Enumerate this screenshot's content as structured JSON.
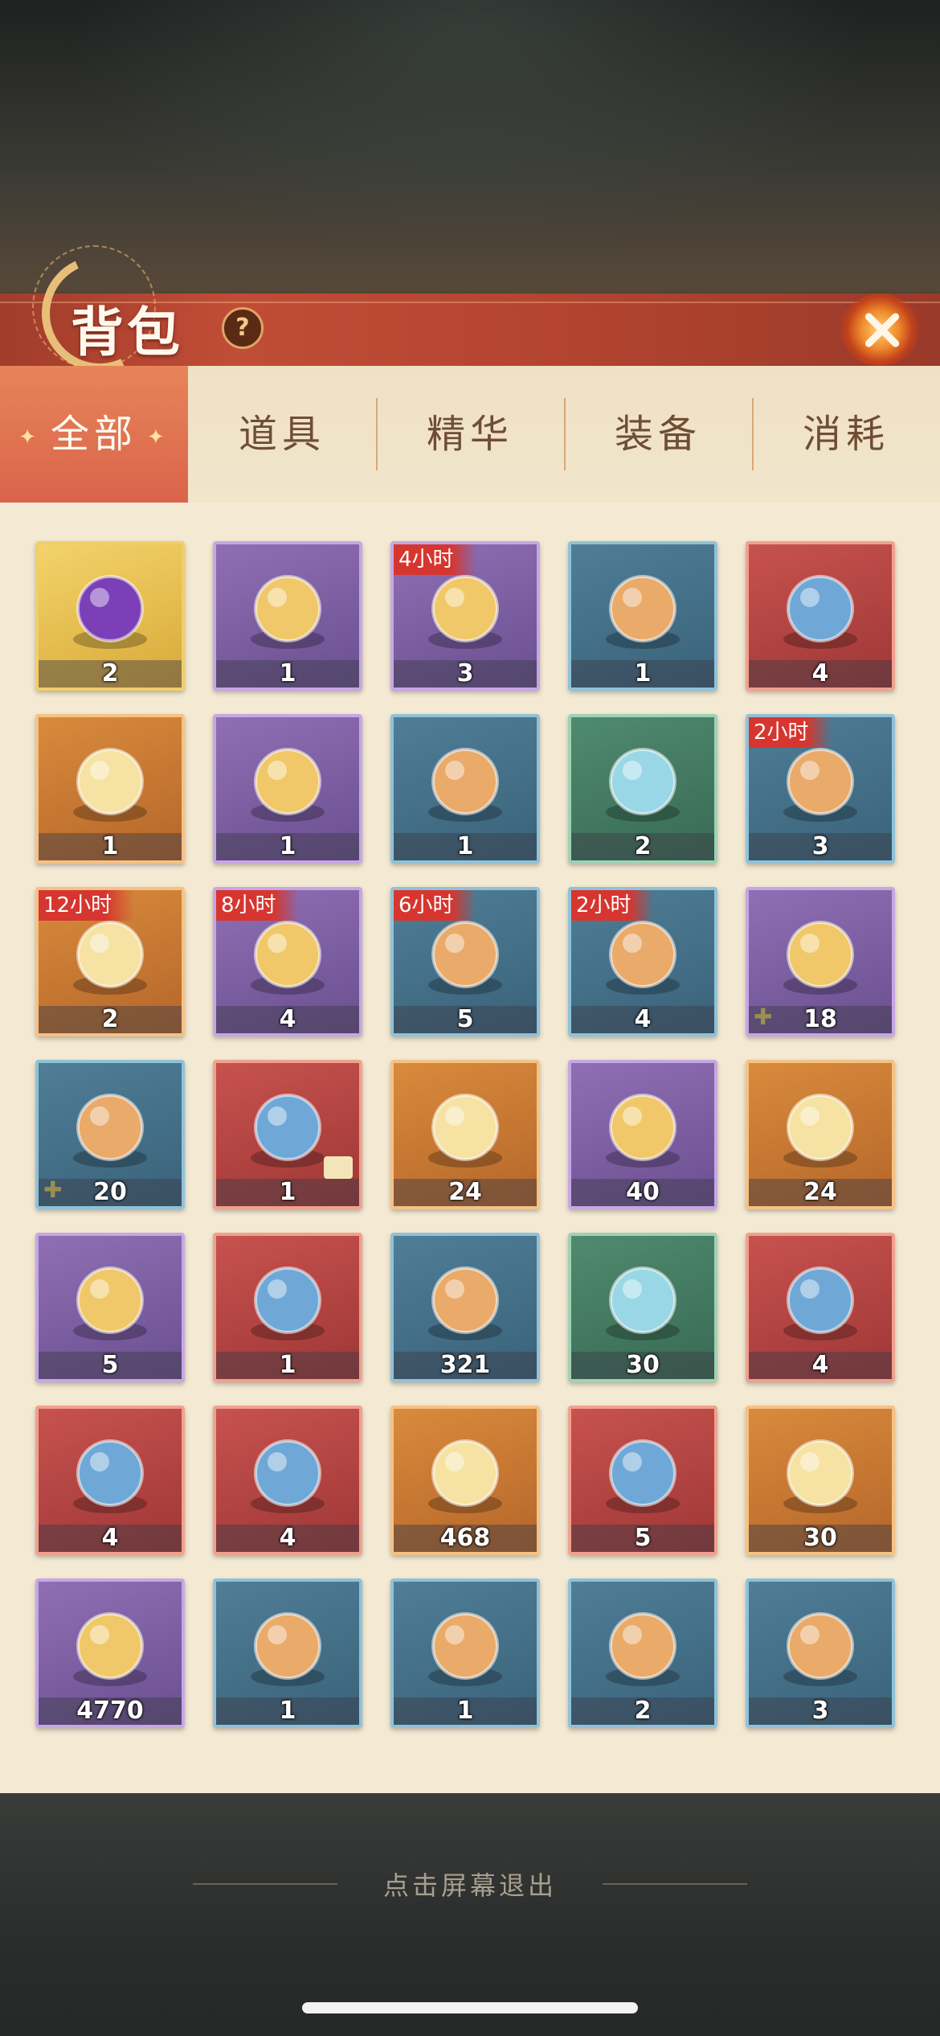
{
  "title": "背包",
  "help_label": "?",
  "tabs": [
    "全部",
    "道具",
    "精华",
    "装备",
    "消耗"
  ],
  "active_tab": "全部",
  "exit_hint": "点击屏幕退出",
  "colors": {
    "title_banner": "#b3442f",
    "active_tab": "#d9644a",
    "panel": "#f4ead4",
    "timer_badge": "#d6362f"
  },
  "items": [
    {
      "icon": "purple-pouch-icon",
      "rarity": "gold",
      "count": "2"
    },
    {
      "icon": "golden-chest-icon",
      "rarity": "purple",
      "count": "1"
    },
    {
      "icon": "orb-treasure-chest-icon",
      "rarity": "purple",
      "count": "3",
      "timer": "4小时"
    },
    {
      "icon": "red-orb-bag-icon",
      "rarity": "blue",
      "count": "1"
    },
    {
      "icon": "blue-pouch-icon",
      "rarity": "red",
      "count": "4"
    },
    {
      "icon": "hero-portrait-box-icon",
      "rarity": "orange",
      "count": "1"
    },
    {
      "icon": "card-box-icon",
      "rarity": "purple",
      "count": "1"
    },
    {
      "icon": "mystery-chest-icon",
      "rarity": "blue",
      "count": "1"
    },
    {
      "icon": "mystery-chest-icon",
      "rarity": "green",
      "count": "2"
    },
    {
      "icon": "orange-orbs-icon",
      "rarity": "blue",
      "count": "3",
      "timer": "2小时"
    },
    {
      "icon": "emerald-chest-icon",
      "rarity": "orange",
      "count": "2",
      "timer": "12小时"
    },
    {
      "icon": "emerald-sack-icon",
      "rarity": "purple",
      "count": "4",
      "timer": "8小时"
    },
    {
      "icon": "emerald-sack-icon",
      "rarity": "blue",
      "count": "5",
      "timer": "6小时"
    },
    {
      "icon": "emerald-pile-icon",
      "rarity": "blue",
      "count": "4",
      "timer": "2小时"
    },
    {
      "icon": "purple-spirit-flame-icon",
      "rarity": "purple",
      "count": "18",
      "fragment": true
    },
    {
      "icon": "blue-spirit-flame-icon",
      "rarity": "blue",
      "count": "20",
      "fragment": true
    },
    {
      "icon": "skin-card-icon",
      "rarity": "red",
      "count": "1",
      "skin": true
    },
    {
      "icon": "purple-potion-bowl-icon",
      "rarity": "orange",
      "count": "24"
    },
    {
      "icon": "potion-flask-icon",
      "rarity": "purple",
      "count": "40"
    },
    {
      "icon": "gold-scroll-icon",
      "rarity": "orange",
      "count": "24"
    },
    {
      "icon": "white-scroll-icon",
      "rarity": "purple",
      "count": "5"
    },
    {
      "icon": "rune-talisman-icon",
      "rarity": "red",
      "count": "1"
    },
    {
      "icon": "ore-stone-icon",
      "rarity": "blue",
      "count": "321"
    },
    {
      "icon": "spirit-crystal-icon",
      "rarity": "green",
      "count": "30"
    },
    {
      "icon": "sand-pile-icon",
      "rarity": "red",
      "count": "4"
    },
    {
      "icon": "flame-gem-icon",
      "rarity": "red",
      "count": "4"
    },
    {
      "icon": "phoenix-feather-icon",
      "rarity": "red",
      "count": "4"
    },
    {
      "icon": "gold-ore-icon",
      "rarity": "orange",
      "count": "468"
    },
    {
      "icon": "sword-banner-icon",
      "rarity": "red",
      "count": "5"
    },
    {
      "icon": "golden-teapot-icon",
      "rarity": "orange",
      "count": "30"
    },
    {
      "icon": "crystal-shard-pile-icon",
      "rarity": "purple",
      "count": "4770"
    },
    {
      "icon": "spiked-mace-icon",
      "rarity": "blue",
      "count": "1"
    },
    {
      "icon": "curved-blade-icon",
      "rarity": "blue",
      "count": "1"
    },
    {
      "icon": "winged-helm-icon",
      "rarity": "blue",
      "count": "2"
    },
    {
      "icon": "red-armor-icon",
      "rarity": "blue",
      "count": "3"
    }
  ]
}
